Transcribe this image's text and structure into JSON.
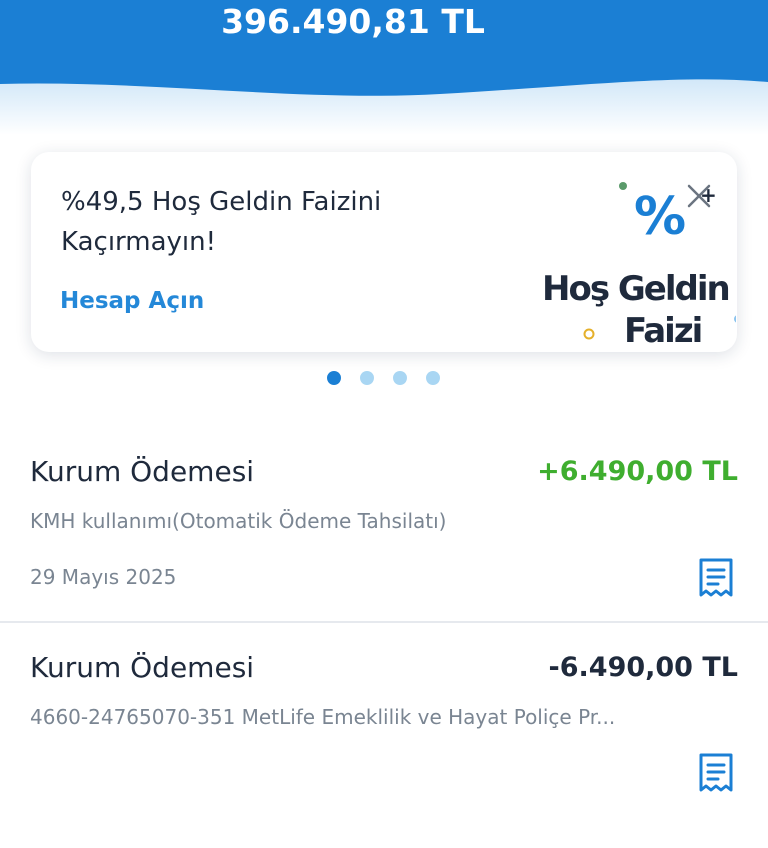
{
  "header": {
    "balance": "396.490,81 TL",
    "background_color": "#1b7fd4"
  },
  "promo": {
    "title_line1": "%49,5 Hoş Geldin Faizini",
    "title_line2": "Kaçırmayın!",
    "link_label": "Hesap Açın",
    "graphic_percent": "%",
    "graphic_line1": "Hoş Geldin",
    "graphic_line2": "Faizi",
    "close_icon": "close-icon",
    "carousel_active_index": 0,
    "carousel_count": 4
  },
  "transactions": [
    {
      "title": "Kurum Ödemesi",
      "amount": "+6.490,00 TL",
      "amount_color": "#3fae2f",
      "description": "KMH kullanımı(Otomatik Ödeme Tahsilatı)",
      "date": "29 Mayıs 2025",
      "icon": "receipt-icon"
    },
    {
      "title": "Kurum Ödemesi",
      "amount": "-6.490,00 TL",
      "amount_color": "#1f2a3c",
      "description": "4660-24765070-351 MetLife Emeklilik ve Hayat Poliçe Pr...",
      "date": "",
      "icon": "receipt-icon"
    }
  ],
  "colors": {
    "accent": "#1b7fd4",
    "link": "#2488d8",
    "positive": "#3fae2f",
    "text": "#1f2a3c",
    "muted": "#7a8592"
  }
}
